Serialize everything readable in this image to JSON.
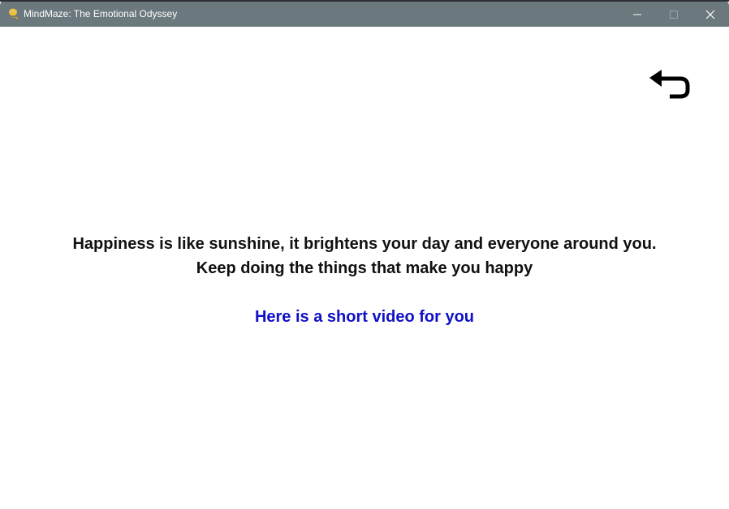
{
  "window": {
    "title": "MindMaze: The Emotional Odyssey",
    "app_icon": "python-snake-icon",
    "controls": {
      "minimize_icon": "minimize-icon",
      "maximize_icon": "maximize-icon",
      "close_icon": "close-icon"
    }
  },
  "content": {
    "back_icon": "return-arrow-icon",
    "message_line_1": "Happiness is like sunshine, it brightens your day and everyone around you.",
    "message_line_2": "Keep doing the things that make you happy",
    "video_link": "Here is a short video for you"
  },
  "colors": {
    "titlebar": "#6b787d",
    "text": "#111111",
    "link": "#1010c8",
    "background": "#ffffff"
  }
}
